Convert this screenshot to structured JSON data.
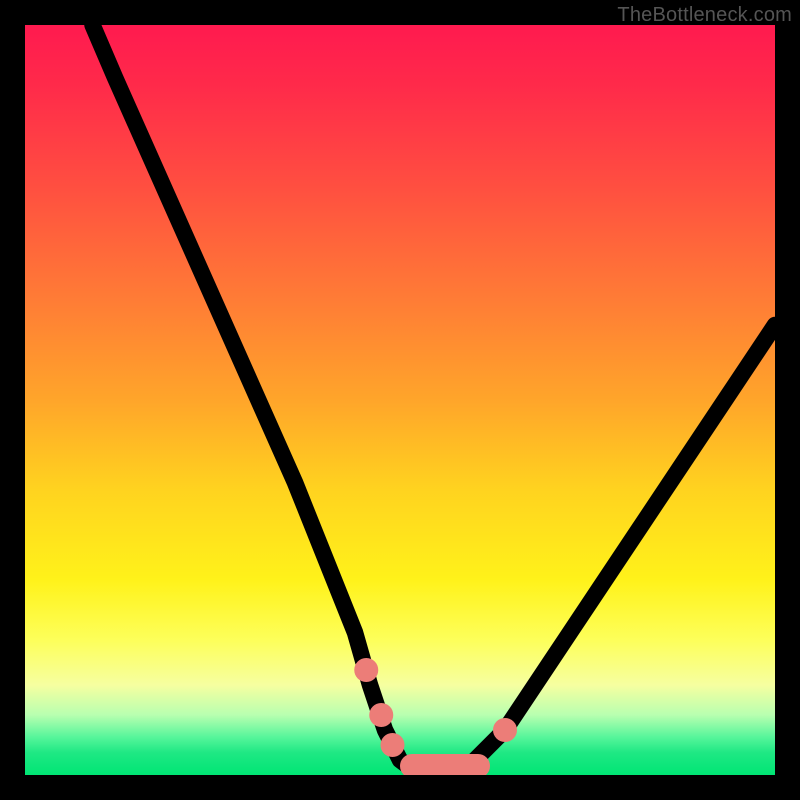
{
  "watermark": "TheBottleneck.com",
  "colors": {
    "frame": "#000000",
    "curve": "#000000",
    "marker": "#ec7d78",
    "gradient_stops": [
      "#ff1a4f",
      "#ff2a4a",
      "#ff5040",
      "#ff7a36",
      "#ffa52a",
      "#ffd31f",
      "#fff21a",
      "#fdff5a",
      "#f6ffa0",
      "#b8ffb0",
      "#55f59a",
      "#1fe884",
      "#00e574"
    ]
  },
  "chart_data": {
    "type": "line",
    "title": "",
    "xlabel": "",
    "ylabel": "",
    "xlim": [
      0,
      100
    ],
    "ylim": [
      0,
      100
    ],
    "note": "No axes or tick labels are shown; x is horizontal percent, y is vertical percent (0 at bottom).",
    "series": [
      {
        "name": "curve",
        "x": [
          9,
          12,
          16,
          20,
          24,
          28,
          32,
          36,
          40,
          42,
          44,
          46,
          48,
          50,
          52,
          54,
          56,
          58,
          60,
          64,
          70,
          76,
          82,
          88,
          94,
          100
        ],
        "y": [
          100,
          93,
          84,
          75,
          66,
          57,
          48,
          39,
          29,
          24,
          19,
          12,
          6,
          2,
          0.5,
          0.2,
          0.2,
          0.5,
          2,
          6,
          15,
          24,
          33,
          42,
          51,
          60
        ]
      }
    ],
    "markers": [
      {
        "shape": "circle",
        "x": 45.5,
        "y": 14,
        "r": 1.6
      },
      {
        "shape": "circle",
        "x": 47.5,
        "y": 8,
        "r": 1.6
      },
      {
        "shape": "circle",
        "x": 49.0,
        "y": 4,
        "r": 1.6
      },
      {
        "shape": "pill",
        "x0": 50.0,
        "x1": 62.0,
        "y": 1.2,
        "r": 1.6
      },
      {
        "shape": "circle",
        "x": 64.0,
        "y": 6,
        "r": 1.6
      }
    ]
  }
}
